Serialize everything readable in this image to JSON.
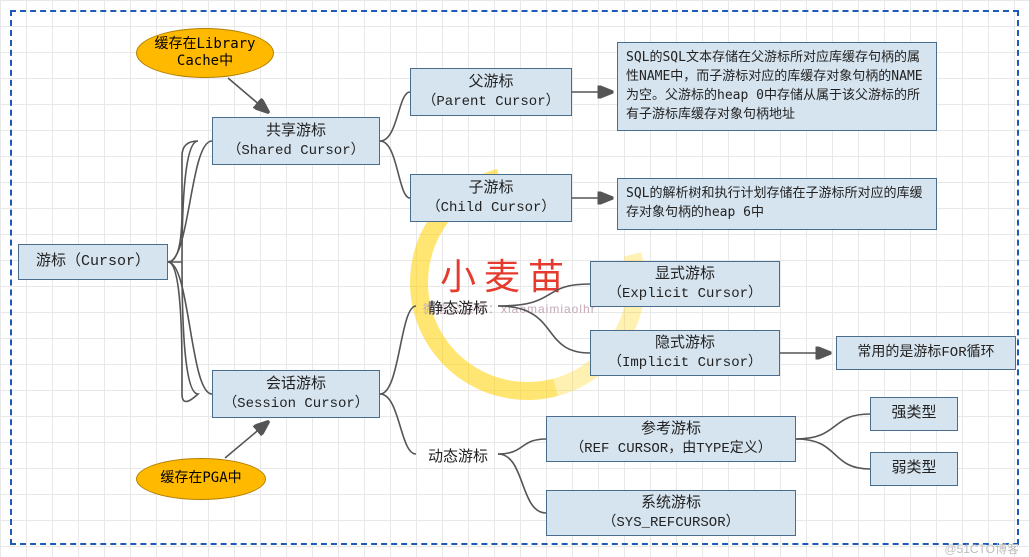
{
  "root": {
    "title": "游标（Cursor）"
  },
  "shared": {
    "title1": "共享游标",
    "title2": "（Shared Cursor）"
  },
  "session": {
    "title1": "会话游标",
    "title2": "（Session Cursor）"
  },
  "parent": {
    "title1": "父游标",
    "title2": "（Parent Cursor）"
  },
  "child": {
    "title1": "子游标",
    "title2": "（Child Cursor）"
  },
  "static_label": "静态游标",
  "dynamic_label": "动态游标",
  "explicit": {
    "title1": "显式游标",
    "title2": "（Explicit Cursor）"
  },
  "implicit": {
    "title1": "隐式游标",
    "title2": "（Implicit Cursor）"
  },
  "ref": {
    "title1": "参考游标",
    "title2": "（REF CURSOR，由TYPE定义）"
  },
  "sys": {
    "title1": "系统游标",
    "title2": "（SYS_REFCURSOR）"
  },
  "strong": "强类型",
  "weak": "弱类型",
  "for_loop": "常用的是游标FOR循环",
  "note_parent": "SQL的SQL文本存储在父游标所对应库缓存句柄的属性NAME中，而子游标对应的库缓存对象句柄的NAME为空。父游标的heap 0中存储从属于该父游标的所有子游标库缓存对象句柄地址",
  "note_child": "SQL的解析树和执行计划存储在子游标所对应的库缓存对象句柄的heap 6中",
  "ell_lib": "缓存在Library Cache中",
  "ell_pga": "缓存在PGA中",
  "watermark": "小麦苗",
  "watermark_sub": "微信公众号：xiaomaimiaolhr",
  "credit": "@51CTO博客"
}
